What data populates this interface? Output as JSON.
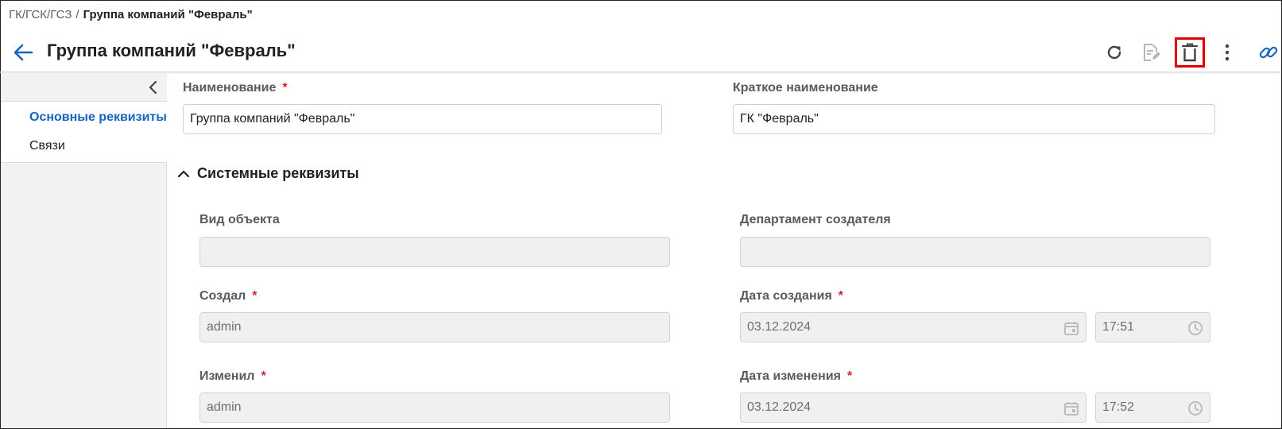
{
  "breadcrumb": {
    "path": "ГК/ГСК/ГСЗ",
    "separator": "/",
    "current": "Группа компаний \"Февраль\""
  },
  "header": {
    "title": "Группа компаний \"Февраль\"",
    "back_icon": "arrow-left-icon",
    "toolbar": [
      {
        "name": "refresh",
        "icon": "refresh-icon",
        "state": "enabled"
      },
      {
        "name": "edit",
        "icon": "edit-document-icon",
        "state": "disabled"
      },
      {
        "name": "delete",
        "icon": "trash-icon",
        "state": "enabled",
        "highlighted": true
      },
      {
        "name": "more",
        "icon": "more-vertical-icon",
        "state": "enabled"
      },
      {
        "name": "link",
        "icon": "link-icon",
        "state": "enabled"
      }
    ]
  },
  "sidebar": {
    "collapse_icon": "chevron-left-icon",
    "items": [
      {
        "label": "Основные реквизиты",
        "active": true
      },
      {
        "label": "Связи",
        "active": false
      }
    ]
  },
  "form": {
    "name": {
      "label": "Наименование",
      "required_mark": "*",
      "value": "Группа компаний \"Февраль\""
    },
    "short_name": {
      "label": "Краткое наименование",
      "value": "ГК \"Февраль\""
    }
  },
  "system_section": {
    "title": "Системные реквизиты",
    "expanded": true,
    "object_type": {
      "label": "Вид объекта",
      "value": ""
    },
    "creator_department": {
      "label": "Департамент создателя",
      "value": ""
    },
    "created_by": {
      "label": "Создал",
      "required_mark": "*",
      "value": "admin"
    },
    "created_date": {
      "label": "Дата создания",
      "required_mark": "*",
      "date": "03.12.2024",
      "time": "17:51"
    },
    "modified_by": {
      "label": "Изменил",
      "required_mark": "*",
      "value": "admin"
    },
    "modified_date": {
      "label": "Дата изменения",
      "required_mark": "*",
      "date": "03.12.2024",
      "time": "17:52"
    }
  },
  "colors": {
    "accent": "#1565c0",
    "required": "#c62828",
    "highlight_box": "#e00000",
    "disabled_bg": "#f0f0f0"
  }
}
